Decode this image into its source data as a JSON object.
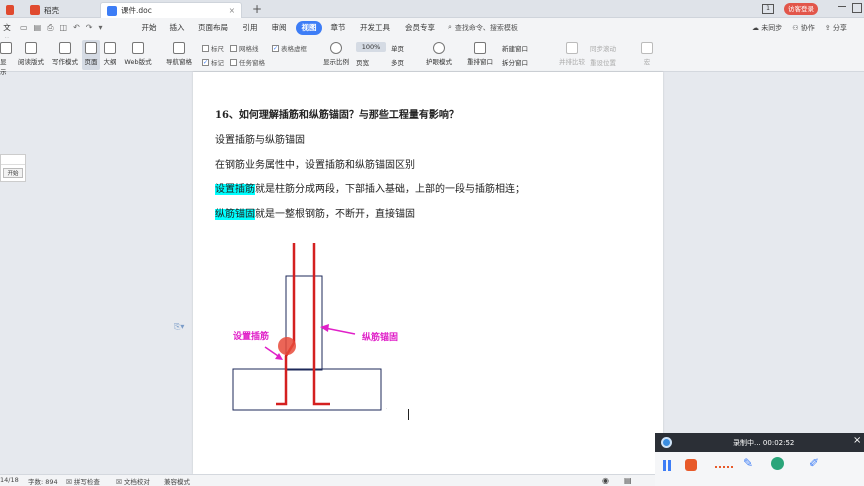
{
  "tabs": {
    "home": "稻壳",
    "doc": "课件.doc",
    "add": "+"
  },
  "window": {
    "window_num": "1",
    "login": "访客登录"
  },
  "menu": {
    "file": "文件",
    "items": [
      "开始",
      "插入",
      "页面布局",
      "引用",
      "审阅",
      "视图",
      "章节",
      "开发工具",
      "会员专享"
    ],
    "active": "视图",
    "search": "查找命令、搜索模板",
    "unsync": "未同步",
    "collab": "协作",
    "share": "分享"
  },
  "toolbar": {
    "buttons": [
      "显示",
      "阅读版式",
      "写作模式",
      "页面",
      "大纲",
      "Web版式",
      "导航窗格"
    ],
    "checks": [
      {
        "label": "标尺",
        "checked": false
      },
      {
        "label": "网格线",
        "checked": false
      },
      {
        "label": "表格虚框",
        "checked": true
      },
      {
        "label": "标记",
        "checked": true
      },
      {
        "label": "任务窗格",
        "checked": false
      }
    ],
    "zoom_label": "显示比例",
    "zoom_value": "100%",
    "page_width": "页宽",
    "single": "单页",
    "multi": "多页",
    "eye": "护眼模式",
    "rearrange": "重排窗口",
    "new_window": "新建窗口",
    "split": "拆分窗口",
    "side_by_side": "并排比较",
    "sync_scroll": "同步滚动",
    "reset_pos": "重设位置",
    "macro": "宏"
  },
  "side_popup": {
    "label": "开始"
  },
  "document": {
    "title": "16、如何理解插筋和纵筋锚固？与那些工程量有影响？",
    "l1": "设置插筋与纵筋锚固",
    "l2": "在钢筋业务属性中，设置插筋和纵筋锚固区别",
    "l3_hl": "设置插筋",
    "l3_rest": "就是柱筋分成两段，下部插入基础，上部的一段与插筋相连；",
    "l4_hl": "纵筋锚固",
    "l4_rest": "就是一整根钢筋，不断开，直接锚固",
    "fig_label_left": "设置插筋",
    "fig_label_right": "纵筋锚固",
    "colors": {
      "rebar": "#d42020",
      "label": "#e020c8",
      "outline": "#1e2a5a"
    }
  },
  "status": {
    "page": "14/18",
    "words": "字数: 894",
    "spell": "拼写检查",
    "proof": "文档校对",
    "compat": "兼容模式"
  },
  "recorder": {
    "status": "录制中...",
    "time": "00:02:52"
  }
}
